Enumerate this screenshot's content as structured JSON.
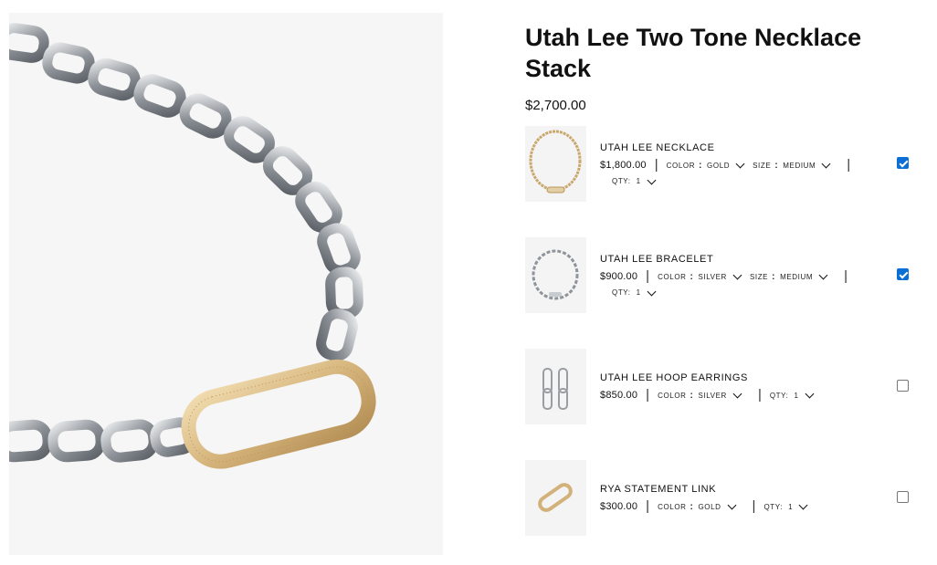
{
  "product": {
    "title": "Utah Lee Two Tone Necklace Stack",
    "price": "$2,700.00",
    "hero_image": "necklace-chain-photo"
  },
  "items": [
    {
      "name": "UTAH LEE NECKLACE",
      "price": "$1,800.00",
      "color_label": "COLOR",
      "color_value": "GOLD",
      "size_label": "SIZE",
      "size_value": "MEDIUM",
      "qty_label": "QTY:",
      "qty_value": "1",
      "checked": true,
      "image": "gold-necklace-thumb"
    },
    {
      "name": "UTAH LEE BRACELET",
      "price": "$900.00",
      "color_label": "COLOR",
      "color_value": "SILVER",
      "size_label": "SIZE",
      "size_value": "MEDIUM",
      "qty_label": "QTY:",
      "qty_value": "1",
      "checked": true,
      "image": "silver-bracelet-thumb"
    },
    {
      "name": "UTAH LEE HOOP EARRINGS",
      "price": "$850.00",
      "color_label": "COLOR",
      "color_value": "SILVER",
      "qty_label": "QTY:",
      "qty_value": "1",
      "checked": false,
      "image": "silver-earrings-thumb"
    },
    {
      "name": "RYA STATEMENT LINK",
      "price": "$300.00",
      "color_label": "COLOR",
      "color_value": "GOLD",
      "qty_label": "QTY:",
      "qty_value": "1",
      "checked": false,
      "image": "gold-link-thumb"
    }
  ],
  "colors": {
    "checkbox_checked": "#0b6fd6",
    "silver": "#9a9ea3",
    "gold": "#d9bc86"
  }
}
